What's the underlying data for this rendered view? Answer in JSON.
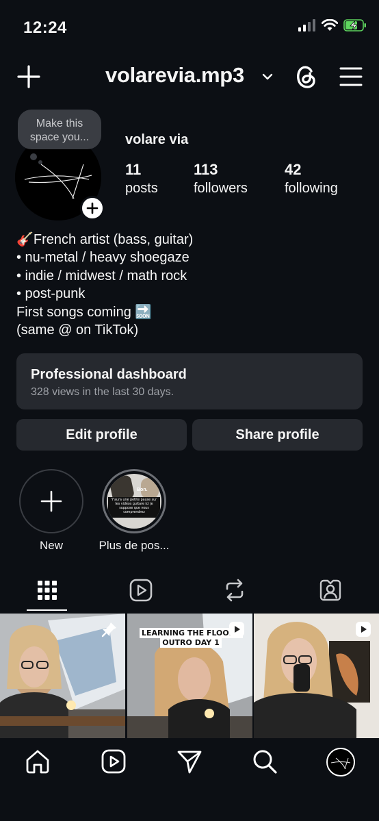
{
  "status_bar": {
    "time": "12:24",
    "icons": [
      "signal-icon",
      "wifi-icon",
      "battery-charging-icon"
    ]
  },
  "header": {
    "username": "volarevia.mp3",
    "left_icon": "plus-icon",
    "right_icons": [
      "threads-icon",
      "menu-icon"
    ]
  },
  "note": {
    "text_line1": "Make this",
    "text_line2": "space you..."
  },
  "profile": {
    "display_name": "volare via",
    "stats": [
      {
        "value": "11",
        "label": "posts"
      },
      {
        "value": "113",
        "label": "followers"
      },
      {
        "value": "42",
        "label": "following"
      }
    ]
  },
  "bio": {
    "lines": [
      "🎸French artist (bass, guitar)",
      "• nu-metal / heavy shoegaze",
      "• indie / midwest / math rock",
      "• post-punk",
      "First songs coming 🔜",
      "(same @ on TikTok)"
    ]
  },
  "dashboard": {
    "title": "Professional dashboard",
    "subtitle": "328 views in the last 30 days."
  },
  "actions": {
    "edit_label": "Edit profile",
    "share_label": "Share profile"
  },
  "highlights": [
    {
      "label": "New"
    },
    {
      "label": "Plus de pos...",
      "thumb_text_top": "Bon.",
      "thumb_text_body": "Y'aura une petite pause sur les vidéos guitare ici je suppose que vous comprendrez"
    }
  ],
  "tabs": [
    "grid-icon",
    "reels-icon",
    "reposts-icon",
    "tagged-icon"
  ],
  "posts": [
    {
      "type": "pinned",
      "icon": "pin-icon"
    },
    {
      "type": "reel",
      "icon": "reel-icon",
      "caption": "LEARNING THE FLOODS OUTRO DAY 1"
    },
    {
      "type": "reel",
      "icon": "reel-icon"
    }
  ],
  "bottom_nav": [
    "home-icon",
    "reels-icon",
    "send-icon",
    "search-icon",
    "profile-avatar"
  ],
  "colors": {
    "background": "#0c0f14",
    "surface": "#26292f",
    "text": "#f5f5f5",
    "muted": "#9da0a6",
    "battery": "#5fd65f"
  }
}
